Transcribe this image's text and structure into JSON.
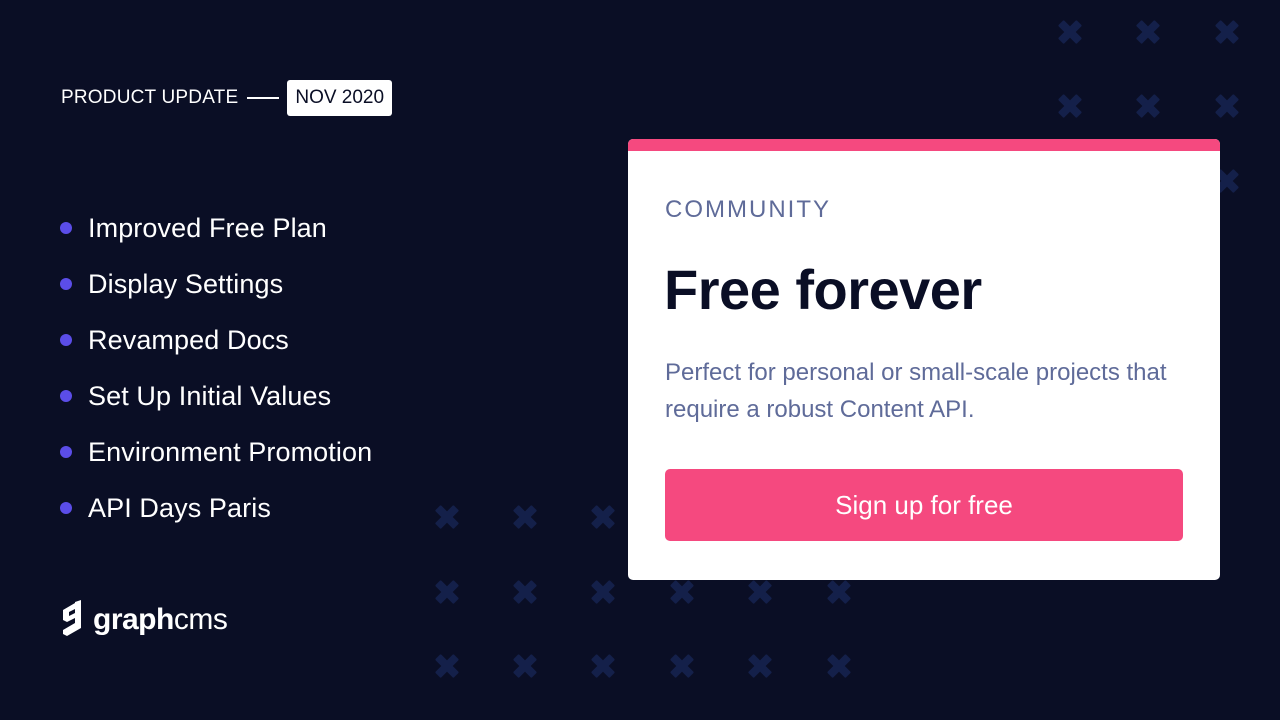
{
  "header": {
    "label": "PRODUCT UPDATE",
    "date_badge": "NOV 2020"
  },
  "features": [
    {
      "label": "Improved Free Plan"
    },
    {
      "label": "Display Settings"
    },
    {
      "label": "Revamped Docs"
    },
    {
      "label": "Set Up Initial Values"
    },
    {
      "label": "Environment Promotion"
    },
    {
      "label": "API Days Paris"
    }
  ],
  "logo": {
    "icon": "graphcms-logo-icon",
    "bold_part": "graph",
    "light_part": "cms"
  },
  "card": {
    "tier": "COMMUNITY",
    "title": "Free forever",
    "description": "Perfect for personal or small-scale projects that require a robust Content API.",
    "cta_label": "Sign up for free"
  },
  "colors": {
    "background": "#0a0e25",
    "accent_pink": "#f5497f",
    "bullet_purple": "#5b4de8",
    "muted_text": "#5f6b99",
    "cross_pattern": "#14204a"
  }
}
